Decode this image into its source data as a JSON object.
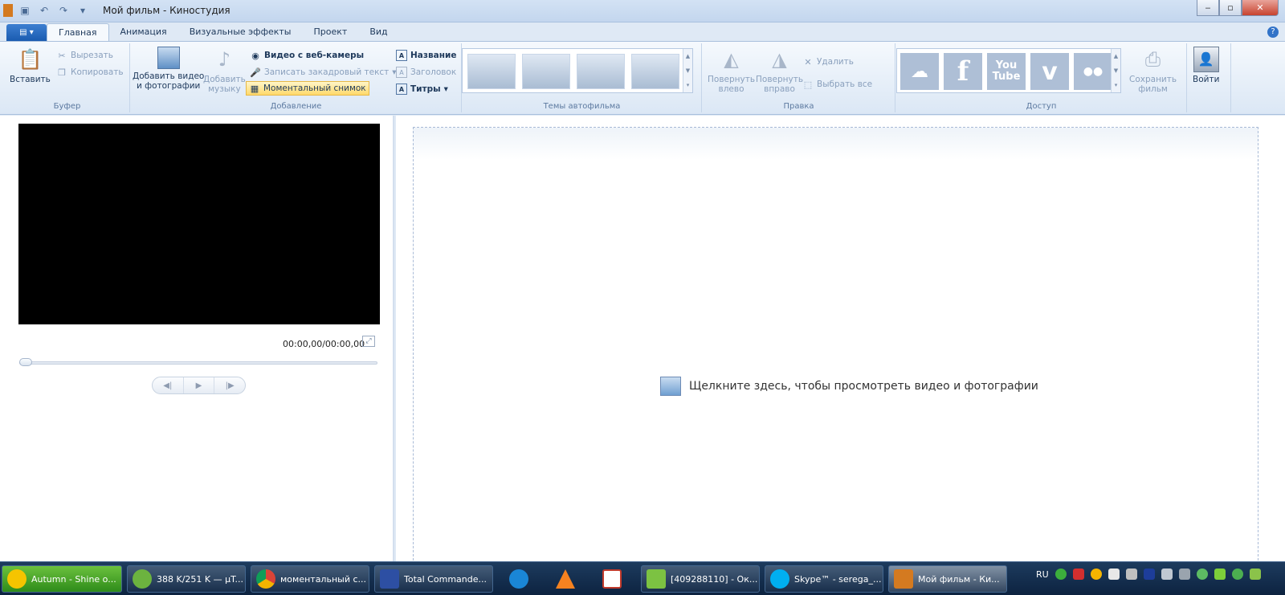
{
  "window": {
    "title": "Мой фильм - Киностудия",
    "controls": {
      "minimize": "‒",
      "maximize": "▫",
      "close": "✕"
    }
  },
  "tabs": [
    "Главная",
    "Анимация",
    "Визуальные эффекты",
    "Проект",
    "Вид"
  ],
  "ribbon": {
    "clipboard": {
      "label": "Буфер",
      "paste": "Вставить",
      "cut": "Вырезать",
      "copy": "Копировать"
    },
    "add": {
      "label": "Добавление",
      "add_video_line1": "Добавить видео",
      "add_video_line2": "и фотографии",
      "add_music_line1": "Добавить",
      "add_music_line2": "музыку",
      "webcam": "Видео с веб-камеры",
      "narration": "Записать закадровый текст",
      "snapshot": "Моментальный снимок",
      "title": "Название",
      "caption": "Заголовок",
      "credits": "Титры"
    },
    "themes": {
      "label": "Темы автофильма"
    },
    "edit": {
      "label": "Правка",
      "rotate_left_line1": "Повернуть",
      "rotate_left_line2": "влево",
      "rotate_right_line1": "Повернуть",
      "rotate_right_line2": "вправо",
      "delete": "Удалить",
      "select_all": "Выбрать все"
    },
    "share": {
      "label": "Доступ",
      "youtube_top": "You",
      "youtube_bottom": "Tube",
      "facebook": "f",
      "vimeo": "v",
      "flickr": "●●",
      "save_movie_line1": "Сохранить",
      "save_movie_line2": "фильм"
    },
    "signin": "Войти"
  },
  "preview": {
    "timecode": "00:00,00/00:00,00"
  },
  "storyboard": {
    "hint": "Щелкните здесь, чтобы просмотреть видео и фотографии"
  },
  "taskbar": {
    "items": [
      "Autumn - Shine o...",
      "388 K/251 K — µT...",
      "моментальный с...",
      "Total Commande...",
      "[409288110] - Ок...",
      "Skype™ - serega_...",
      "Мой фильм - Ки..."
    ],
    "lang": "RU"
  }
}
